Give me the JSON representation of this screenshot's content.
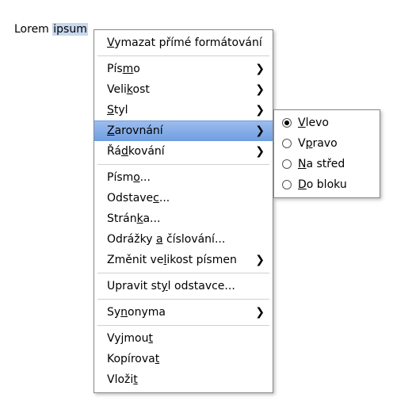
{
  "document": {
    "word1": "Lorem",
    "word2_selected": "ipsum"
  },
  "context_menu": {
    "clear_formatting": {
      "pre": "",
      "mn": "V",
      "post": "ymazat přímé formátování",
      "arrow": false
    },
    "font": {
      "pre": "Pís",
      "mn": "m",
      "post": "o",
      "arrow": true
    },
    "size": {
      "pre": "Veli",
      "mn": "k",
      "post": "ost",
      "arrow": true
    },
    "style": {
      "pre": "",
      "mn": "S",
      "post": "tyl",
      "arrow": true
    },
    "alignment": {
      "pre": "",
      "mn": "Z",
      "post": "arovnání",
      "arrow": true
    },
    "line_spacing": {
      "pre": "Řá",
      "mn": "d",
      "post": "kování",
      "arrow": true
    },
    "font_dialog": {
      "pre": "Písm",
      "mn": "o",
      "post": "...",
      "arrow": false
    },
    "paragraph_dialog": {
      "pre": "Odstave",
      "mn": "c",
      "post": "...",
      "arrow": false
    },
    "page_dialog": {
      "pre": "Strán",
      "mn": "k",
      "post": "a...",
      "arrow": false
    },
    "bullets": {
      "pre": "Odrážky ",
      "mn": "a",
      "post": " číslování...",
      "arrow": false
    },
    "change_case": {
      "pre": "Změnit ve",
      "mn": "l",
      "post": "ikost písmen",
      "arrow": true
    },
    "edit_para_style": {
      "pre": "Upravit st",
      "mn": "y",
      "post": "l odstavce...",
      "arrow": false
    },
    "synonyms": {
      "pre": "Sy",
      "mn": "n",
      "post": "onyma",
      "arrow": true
    },
    "cut": {
      "pre": "Vyjmou",
      "mn": "t",
      "post": "",
      "arrow": false
    },
    "copy": {
      "pre": "Kopírova",
      "mn": "t",
      "post": "",
      "arrow": false
    },
    "paste": {
      "pre": "Vloži",
      "mn": "t",
      "post": "",
      "arrow": false
    }
  },
  "alignment_submenu": {
    "left": {
      "pre": "",
      "mn": "V",
      "post": "levo",
      "checked": true
    },
    "right": {
      "pre": "V",
      "mn": "p",
      "post": "ravo",
      "checked": false
    },
    "center": {
      "pre": "",
      "mn": "N",
      "post": "a střed",
      "checked": false
    },
    "block": {
      "pre": "",
      "mn": "D",
      "post": "o bloku",
      "checked": false
    }
  },
  "glyphs": {
    "arrow": "❯"
  }
}
